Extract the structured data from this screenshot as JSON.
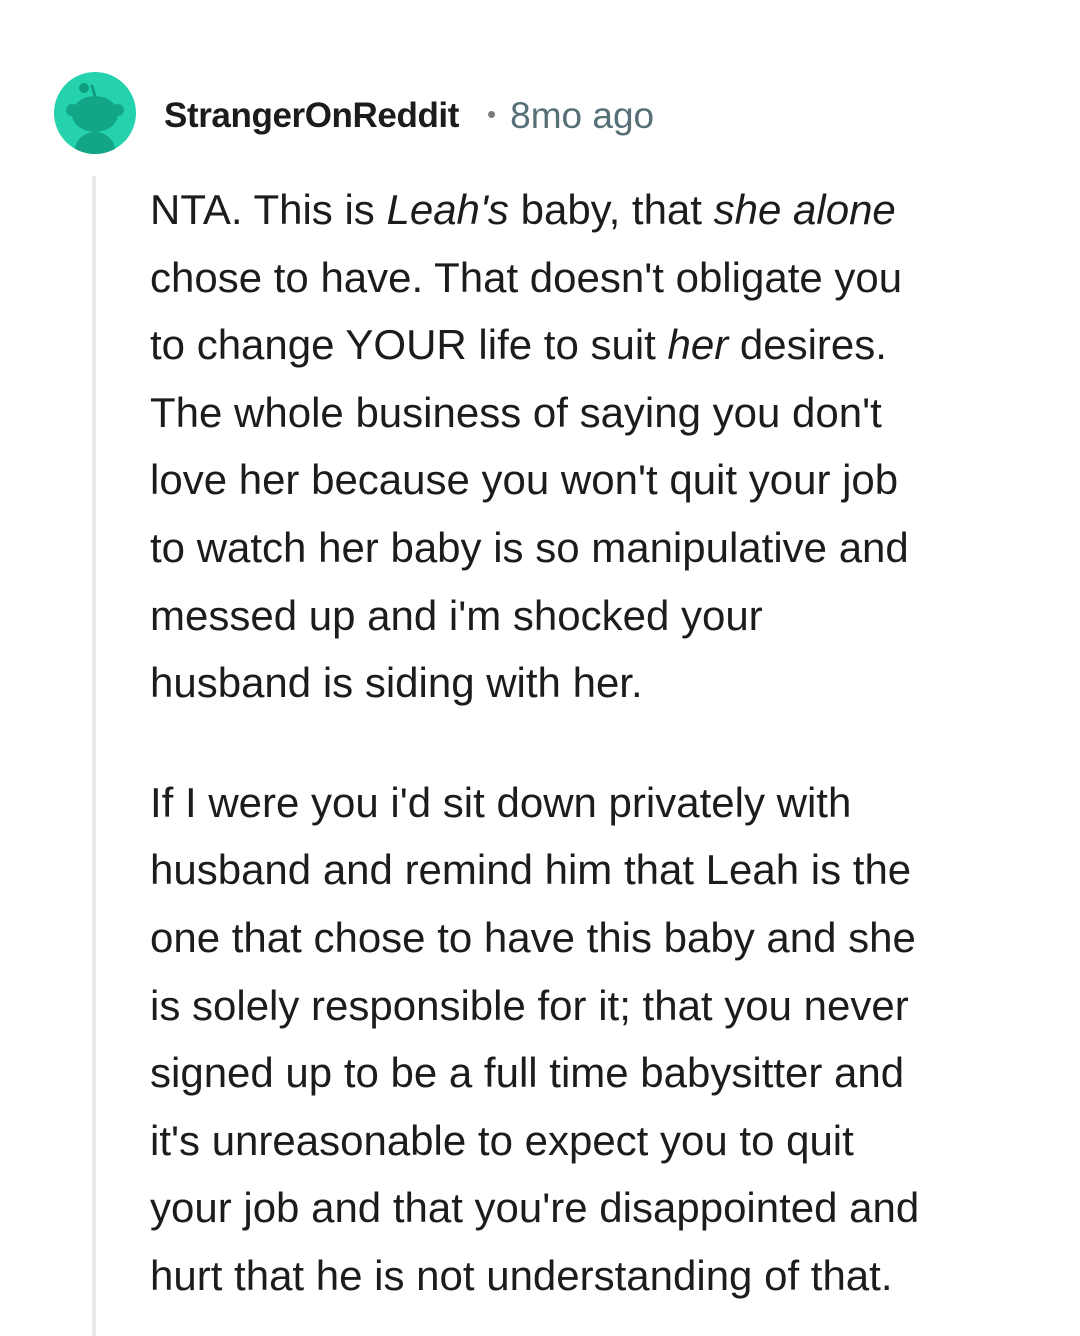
{
  "comment": {
    "author": "StrangerOnReddit",
    "separator": "•",
    "time_ago": "8mo ago",
    "avatar_icon": "reddit-snoo-icon",
    "avatar_color": "#24d3ad",
    "paragraph1": {
      "l1a": "NTA. This is ",
      "l1b": "Leah's",
      "l1c": " baby, that ",
      "l1d": "she alone",
      "l2": "chose to have. That doesn't obligate you",
      "l3a": "to change YOUR life to suit ",
      "l3b": "her",
      "l3c": " desires.",
      "l4": "The whole business of saying you don't",
      "l5": "love her because you won't quit your job",
      "l6": "to watch her baby is so manipulative and",
      "l7": "messed up and i'm shocked your",
      "l8": "husband is siding with her."
    },
    "paragraph2": {
      "l1": "If I were you i'd sit down privately with",
      "l2": "husband and remind him that Leah is the",
      "l3": "one that chose to have this baby and she",
      "l4": "is solely responsible for it; that you never",
      "l5": "signed up to be a full time babysitter and",
      "l6": "it's unreasonable to expect you to quit",
      "l7": "your job and that you're disappointed and",
      "l8": "hurt that he is not understanding of that."
    }
  }
}
